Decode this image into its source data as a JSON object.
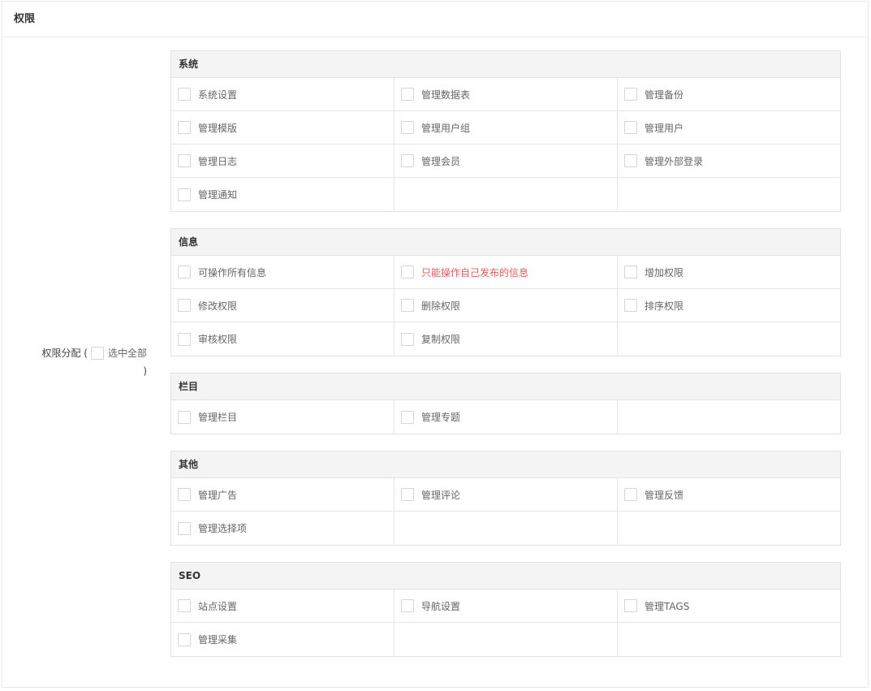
{
  "panel": {
    "title": "权限"
  },
  "assign": {
    "label": "权限分配 (",
    "select_all": "选中全部",
    "close_paren": ")"
  },
  "groups": [
    {
      "title": "系统",
      "items": [
        {
          "label": "系统设置"
        },
        {
          "label": "管理数据表"
        },
        {
          "label": "管理备份"
        },
        {
          "label": "管理模版"
        },
        {
          "label": "管理用户组"
        },
        {
          "label": "管理用户"
        },
        {
          "label": "管理日志"
        },
        {
          "label": "管理会员"
        },
        {
          "label": "管理外部登录"
        },
        {
          "label": "管理通知"
        }
      ]
    },
    {
      "title": "信息",
      "items": [
        {
          "label": "可操作所有信息"
        },
        {
          "label": "只能操作自己发布的信息",
          "highlight": "#e45b5b"
        },
        {
          "label": "增加权限"
        },
        {
          "label": "修改权限"
        },
        {
          "label": "删除权限"
        },
        {
          "label": "排序权限"
        },
        {
          "label": "审核权限"
        },
        {
          "label": "复制权限"
        }
      ]
    },
    {
      "title": "栏目",
      "items": [
        {
          "label": "管理栏目"
        },
        {
          "label": "管理专题"
        }
      ]
    },
    {
      "title": "其他",
      "items": [
        {
          "label": "管理广告"
        },
        {
          "label": "管理评论"
        },
        {
          "label": "管理反馈"
        },
        {
          "label": "管理选择项"
        }
      ]
    },
    {
      "title": "SEO",
      "items": [
        {
          "label": "站点设置"
        },
        {
          "label": "导航设置"
        },
        {
          "label": "管理TAGS"
        },
        {
          "label": "管理采集"
        }
      ]
    }
  ]
}
